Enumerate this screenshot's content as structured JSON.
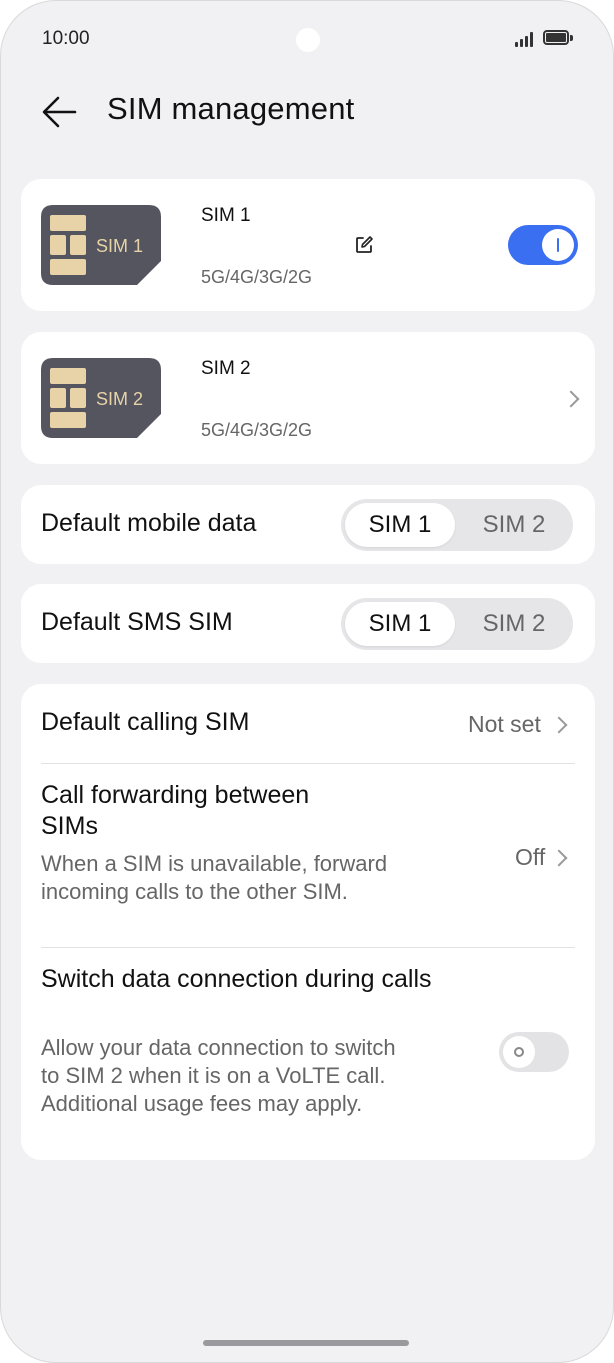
{
  "status_bar": {
    "time": "10:00",
    "icons": [
      "signal-icon",
      "battery-icon"
    ]
  },
  "header": {
    "back_icon": "arrow-left-icon",
    "title": "SIM management"
  },
  "sim_cards": [
    {
      "name": "SIM 1",
      "chip_label": "SIM 1",
      "networks": "5G/4G/3G/2G",
      "enabled": true,
      "edit_icon": "edit-icon"
    },
    {
      "name": "SIM 2",
      "chip_label": "SIM 2",
      "networks": "5G/4G/3G/2G",
      "chevron_icon": "chevron-right-icon"
    }
  ],
  "default_mobile_data": {
    "label": "Default mobile data",
    "options": [
      "SIM 1",
      "SIM 2"
    ],
    "selected": "SIM 1"
  },
  "default_sms": {
    "label": "Default SMS SIM",
    "options": [
      "SIM 1",
      "SIM 2"
    ],
    "selected": "SIM 1"
  },
  "calling": {
    "default_calling": {
      "label": "Default calling SIM",
      "value": "Not set"
    },
    "call_forwarding": {
      "label": "Call forwarding between SIMs",
      "description": "When a SIM is unavailable, forward incoming calls to the other SIM.",
      "value": "Off"
    },
    "switch_data": {
      "label": "Switch data connection during calls",
      "description": "Allow your data connection to switch to SIM 2 when it is on a VoLTE call. Additional usage fees may apply.",
      "enabled": false
    }
  },
  "colors": {
    "accent": "#3a6ff2",
    "background": "#f1f1f3",
    "card": "#ffffff",
    "sim_chip": "#55555f",
    "chip_gold": "#e8d3a8"
  }
}
